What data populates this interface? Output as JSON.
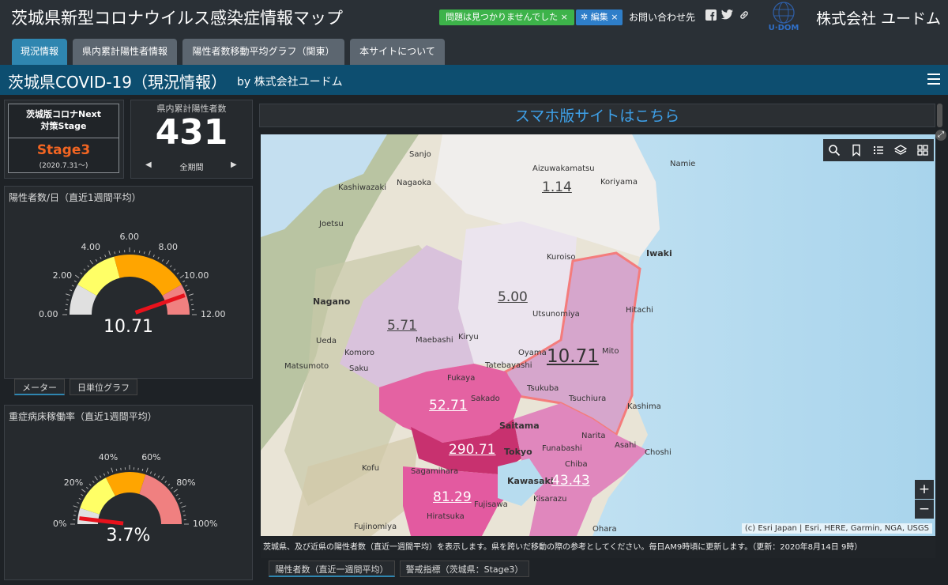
{
  "header": {
    "site_title": "茨城県新型コロナウイルス感染症情報マップ",
    "notice_label": "問題は見つかりませんでした",
    "edit_label": "編集",
    "contact_label": "お問い合わせ先",
    "company_name": "株式会社 ユードム",
    "logo_text": "U·DOM"
  },
  "tabs": [
    {
      "label": "現況情報",
      "active": true
    },
    {
      "label": "県内累計陽性者情報",
      "active": false
    },
    {
      "label": "陽性者数移動平均グラフ（関東）",
      "active": false
    },
    {
      "label": "本サイトについて",
      "active": false
    }
  ],
  "subheader": {
    "title": "茨城県COVID-19（現況情報）",
    "by": "by 株式会社ユードム"
  },
  "stage": {
    "heading_line1": "茨城版コロナNext",
    "heading_line2": "対策Stage",
    "value": "Stage3",
    "date": "(2020.7.31～)"
  },
  "cumulative": {
    "label": "県内累計陽性者数",
    "value": "431",
    "period": "全期間"
  },
  "gauge1": {
    "title": "陽性者数/日（直近1週間平均）",
    "value": "10.71",
    "value_num": 10.71,
    "min": 0,
    "max": 12,
    "ticks": [
      "0.00",
      "2.00",
      "4.00",
      "6.00",
      "8.00",
      "10.00",
      "12.00"
    ],
    "colors": [
      "#e0e0e0",
      "#ffff66",
      "#ffa500",
      "#f08080"
    ]
  },
  "gauge_tabs": [
    {
      "label": "メーター",
      "active": true
    },
    {
      "label": "日単位グラフ",
      "active": false
    }
  ],
  "gauge2": {
    "title": "重症病床稼働率（直近1週間平均）",
    "value": "3.7%",
    "value_num": 3.7,
    "min": 0,
    "max": 100,
    "ticks": [
      "0%",
      "20%",
      "40%",
      "60%",
      "80%",
      "100%"
    ],
    "colors": [
      "#e0e0e0",
      "#ffff66",
      "#ffa500",
      "#f08080"
    ]
  },
  "map": {
    "banner": "スマホ版サイトはこちら",
    "regions": [
      {
        "name": "fukushima",
        "value": "1.14"
      },
      {
        "name": "tochigi",
        "value": "5.00"
      },
      {
        "name": "gunma",
        "value": "5.71"
      },
      {
        "name": "ibaraki",
        "value": "10.71"
      },
      {
        "name": "saitama",
        "value": "52.71"
      },
      {
        "name": "tokyo",
        "value": "290.71"
      },
      {
        "name": "chiba",
        "value": "43.43"
      },
      {
        "name": "kanagawa",
        "value": "81.29"
      }
    ],
    "places": [
      "Sanjo",
      "Kashiwazaki",
      "Nagaoka",
      "Joetsu",
      "Nagano",
      "Ueda",
      "Komoro",
      "Matsumoto",
      "Saku",
      "Kofu",
      "Fujinomiya",
      "Maebashi",
      "Kiryu",
      "Oyama",
      "Tatebayashi",
      "Fukaya",
      "Sakado",
      "Saitama",
      "Tokyo",
      "Kawasaki",
      "Sagamihara",
      "Fujisawa",
      "Hiratsuka",
      "Funabashi",
      "Chiba",
      "Kisarazu",
      "Ohara",
      "Choshi",
      "Asahi",
      "Narita",
      "Kashima",
      "Tsuchiura",
      "Tsukuba",
      "Mito",
      "Hitachi",
      "Iwaki",
      "Koriyama",
      "Utsunomiya",
      "Kuroiso",
      "Aizuwakamatsu",
      "Namie"
    ],
    "attribution": "(c) Esri Japan | Esri, HERE, Garmin, NGA, USGS",
    "note": "茨城県、及び近県の陽性者数（直近一週間平均）を表示します。県を跨いだ移動の際の参考としてください。毎日AM9時頃に更新します。（更新：2020年8月14日 9時）"
  },
  "map_tabs": [
    {
      "label": "陽性者数（直近一週間平均）",
      "active": true
    },
    {
      "label": "警戒指標（茨城県：Stage3）",
      "active": false
    }
  ]
}
